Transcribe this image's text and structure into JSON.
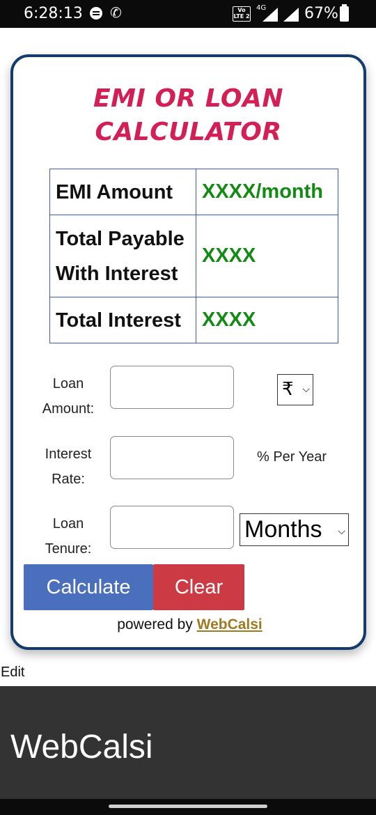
{
  "status_bar": {
    "time": "6:28:13",
    "network": "4G",
    "battery": "67%",
    "volte": "Vo LTE 2"
  },
  "calculator": {
    "title": "EMI OR LOAN CALCULATOR",
    "results": [
      {
        "label": "EMI Amount",
        "value": "XXXX/month"
      },
      {
        "label": "Total Payable With Interest",
        "value": "XXXX"
      },
      {
        "label": "Total Interest",
        "value": "XXXX"
      }
    ],
    "fields": {
      "loan_amount_label": "Loan Amount:",
      "currency": "₹",
      "interest_rate_label": "Interest Rate:",
      "interest_unit": "% Per Year",
      "loan_tenure_label": "Loan Tenure:",
      "tenure_unit": "Months"
    },
    "buttons": {
      "calculate": "Calculate",
      "clear": "Clear"
    },
    "powered_by": "powered by",
    "powered_link": "WebCalsi"
  },
  "edit_link": "Edit",
  "footer": {
    "title": "WebCalsi"
  },
  "colors": {
    "title": "#d21f55",
    "value": "#138a13",
    "calculate_button": "#4a6fbd",
    "clear_button": "#cc3a44",
    "card_border": "#133b6b",
    "footer_bg": "#333333"
  }
}
